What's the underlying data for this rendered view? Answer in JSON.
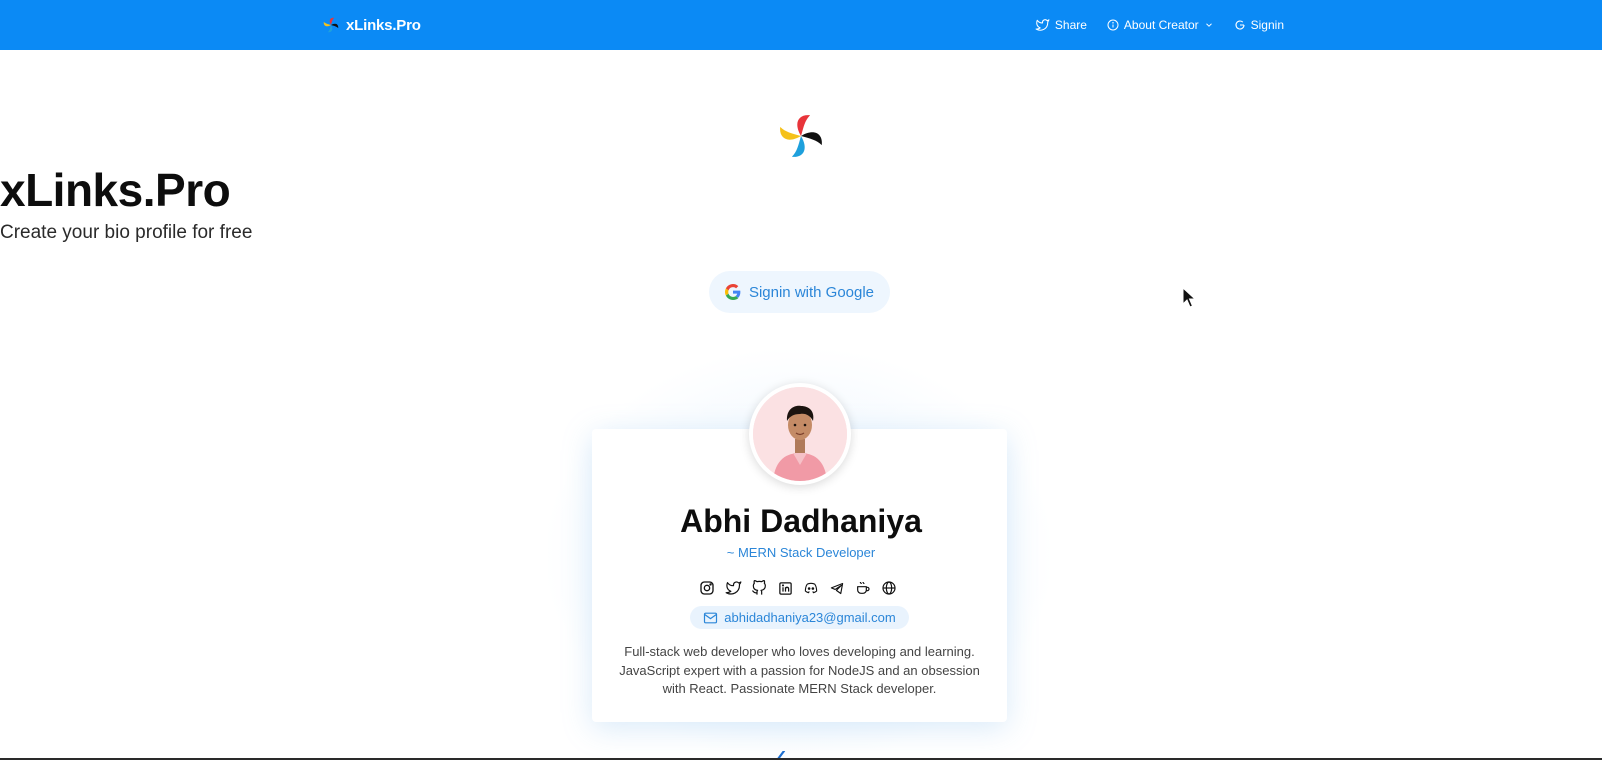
{
  "navbar": {
    "brand": "xLinks.Pro",
    "share_label": "Share",
    "about_label": "About Creator",
    "signin_label": "Signin",
    "bg_color": "#0b8af5"
  },
  "hero": {
    "title": "xLinks.Pro",
    "subtitle": "Create your bio profile for free",
    "google_button_label": "Signin with Google"
  },
  "profile": {
    "name": "Abhi Dadhaniya",
    "role": "~ MERN Stack Developer",
    "email": "abhidadhaniya23@gmail.com",
    "bio": "Full-stack web developer who loves developing and learning. JavaScript expert with a passion for NodeJS and an obsession with React. Passionate MERN Stack developer.",
    "socials": [
      "instagram-icon",
      "twitter-icon",
      "github-icon",
      "linkedin-icon",
      "discord-icon",
      "telegram-icon",
      "coffee-icon",
      "globe-icon"
    ]
  },
  "colors": {
    "accent": "#2b86d8",
    "logo_red": "#e8343a",
    "logo_black": "#111111",
    "logo_yellow": "#f5c11a",
    "logo_blue": "#1ea0dc"
  }
}
